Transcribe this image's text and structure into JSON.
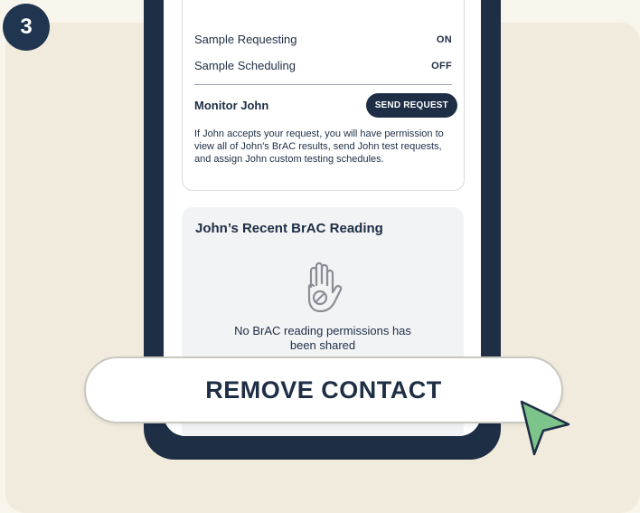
{
  "step": {
    "number": "3"
  },
  "permissions": {
    "rows": [
      {
        "label": "Sample Requesting",
        "value": "ON"
      },
      {
        "label": "Sample Scheduling",
        "value": "OFF"
      }
    ],
    "monitor_label": "Monitor John",
    "send_request_label": "SEND REQUEST",
    "description": "If John accepts your request, you will have permission to view all of John's BrAC results, send John test requests, and assign John custom testing schedules."
  },
  "reading": {
    "title": "John’s Recent BrAC Reading",
    "icon": "hand-stop-icon",
    "message_line1": "No BrAC reading permissions has",
    "message_line2": "been shared"
  },
  "actions": {
    "remove_contact_label": "REMOVE CONTACT"
  },
  "colors": {
    "navy": "#1e2e44",
    "cursor_green": "#7cc48a",
    "background": "#f1ebdd"
  }
}
